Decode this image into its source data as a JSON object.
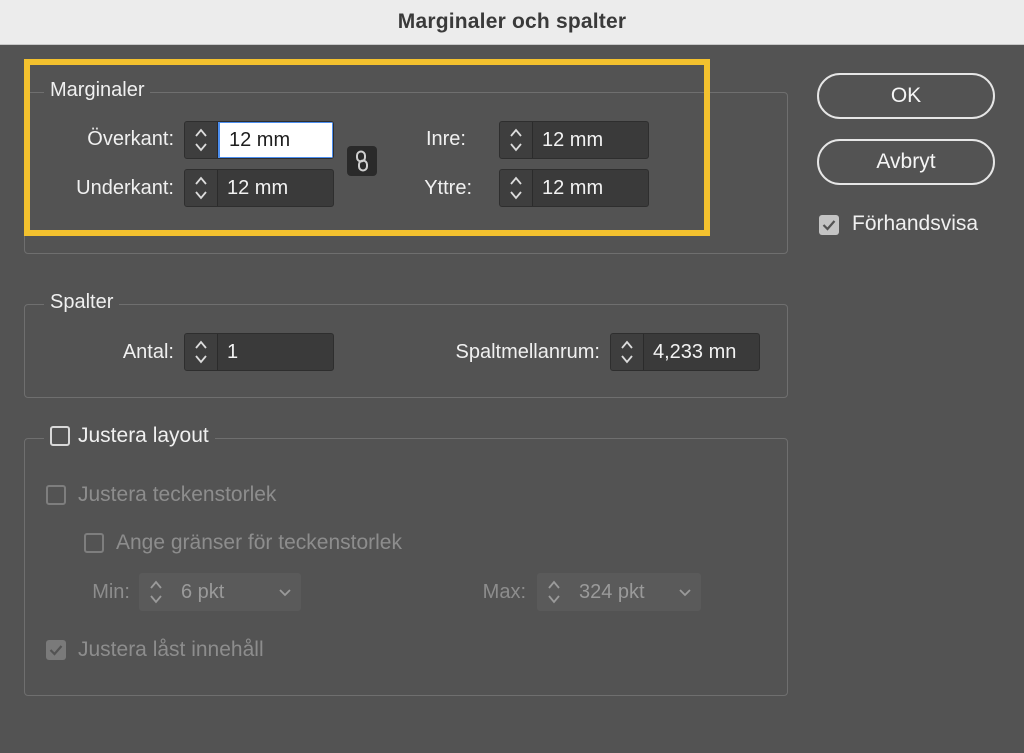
{
  "dialog": {
    "title": "Marginaler och spalter"
  },
  "margins": {
    "legend": "Marginaler",
    "top_label": "Överkant:",
    "top_value": "12 mm",
    "bottom_label": "Underkant:",
    "bottom_value": "12 mm",
    "inside_label": "Inre:",
    "inside_value": "12 mm",
    "outside_label": "Yttre:",
    "outside_value": "12 mm"
  },
  "columns": {
    "legend": "Spalter",
    "count_label": "Antal:",
    "count_value": "1",
    "gutter_label": "Spaltmellanrum:",
    "gutter_value": "4,233 mn"
  },
  "adjust": {
    "layout_label": "Justera layout",
    "font_size_label": "Justera teckenstorlek",
    "limits_label": "Ange gränser för teckenstorlek",
    "min_label": "Min:",
    "min_value": "6 pkt",
    "max_label": "Max:",
    "max_value": "324 pkt",
    "locked_label": "Justera låst innehåll"
  },
  "buttons": {
    "ok": "OK",
    "cancel": "Avbryt"
  },
  "preview": {
    "label": "Förhandsvisa",
    "checked": true
  },
  "colors": {
    "background": "#535353",
    "highlight": "#f3c12e",
    "focus": "#4d8ff0"
  }
}
